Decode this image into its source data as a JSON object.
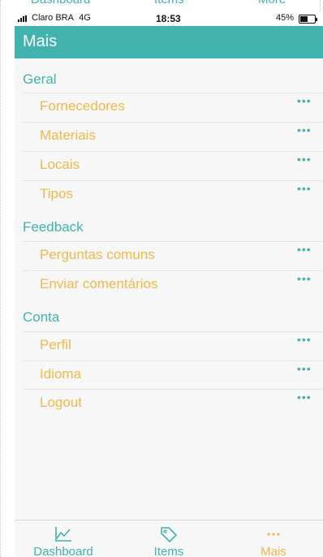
{
  "ghost_tabs": [
    "Dashboard",
    "Items",
    "More"
  ],
  "status_bar": {
    "carrier": "Claro BRA",
    "network": "4G",
    "time": "18:53",
    "battery_percent": "45%",
    "battery_level": 0.45
  },
  "nav": {
    "title": "Mais"
  },
  "sections": [
    {
      "header": "Geral",
      "items": [
        "Fornecedores",
        "Materiais",
        "Locais",
        "Tipos"
      ]
    },
    {
      "header": "Feedback",
      "items": [
        "Perguntas comuns",
        "Enviar comentários"
      ]
    },
    {
      "header": "Conta",
      "items": [
        "Perfil",
        "Idioma",
        "Logout"
      ]
    }
  ],
  "more_glyph": "•••",
  "tabs": [
    {
      "label": "Dashboard",
      "icon": "chart-line-icon",
      "active": false
    },
    {
      "label": "Items",
      "icon": "tag-icon",
      "active": false
    },
    {
      "label": "Mais",
      "icon": "more-dots-icon",
      "active": true
    }
  ],
  "colors": {
    "accent": "#41b2ad",
    "item_text": "#f0b84b",
    "background": "#f7f7f7"
  }
}
